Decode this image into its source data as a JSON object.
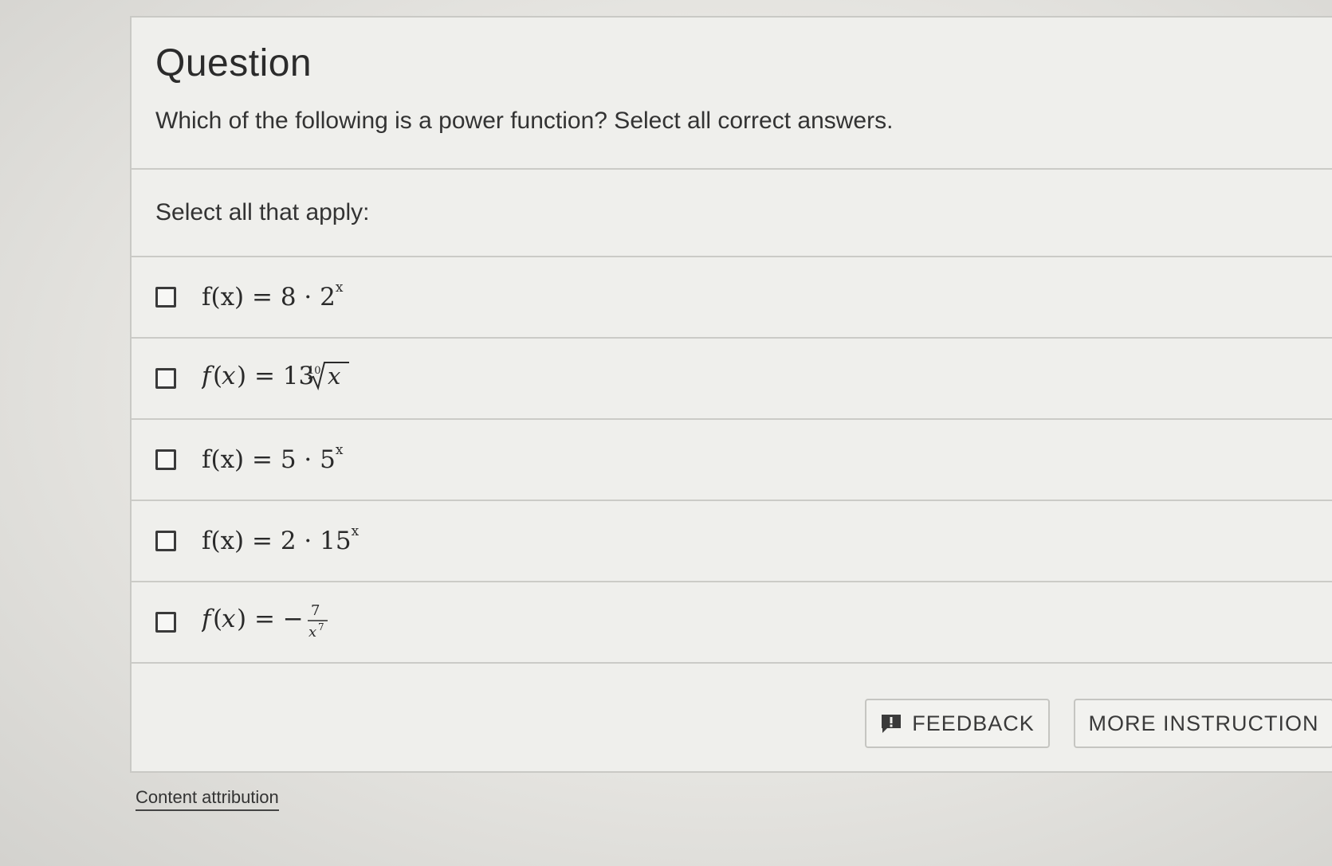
{
  "question": {
    "title": "Question",
    "prompt": "Which of the following is a power function? Select all correct answers."
  },
  "instruction": "Select all that apply:",
  "options": [
    {
      "base": "f(x) = 8 · 2",
      "exp": "x"
    },
    {
      "text": "f(x) = 13∜x (10th root of x)"
    },
    {
      "base": "f(x) = 5 · 5",
      "exp": "x"
    },
    {
      "base": "f(x) = 2 · 15",
      "exp": "x"
    },
    {
      "text": "f(x) = −7/x⁷"
    }
  ],
  "buttons": {
    "feedback": "FEEDBACK",
    "more_instruction": "MORE INSTRUCTION"
  },
  "footer": {
    "attribution": "Content attribution"
  }
}
